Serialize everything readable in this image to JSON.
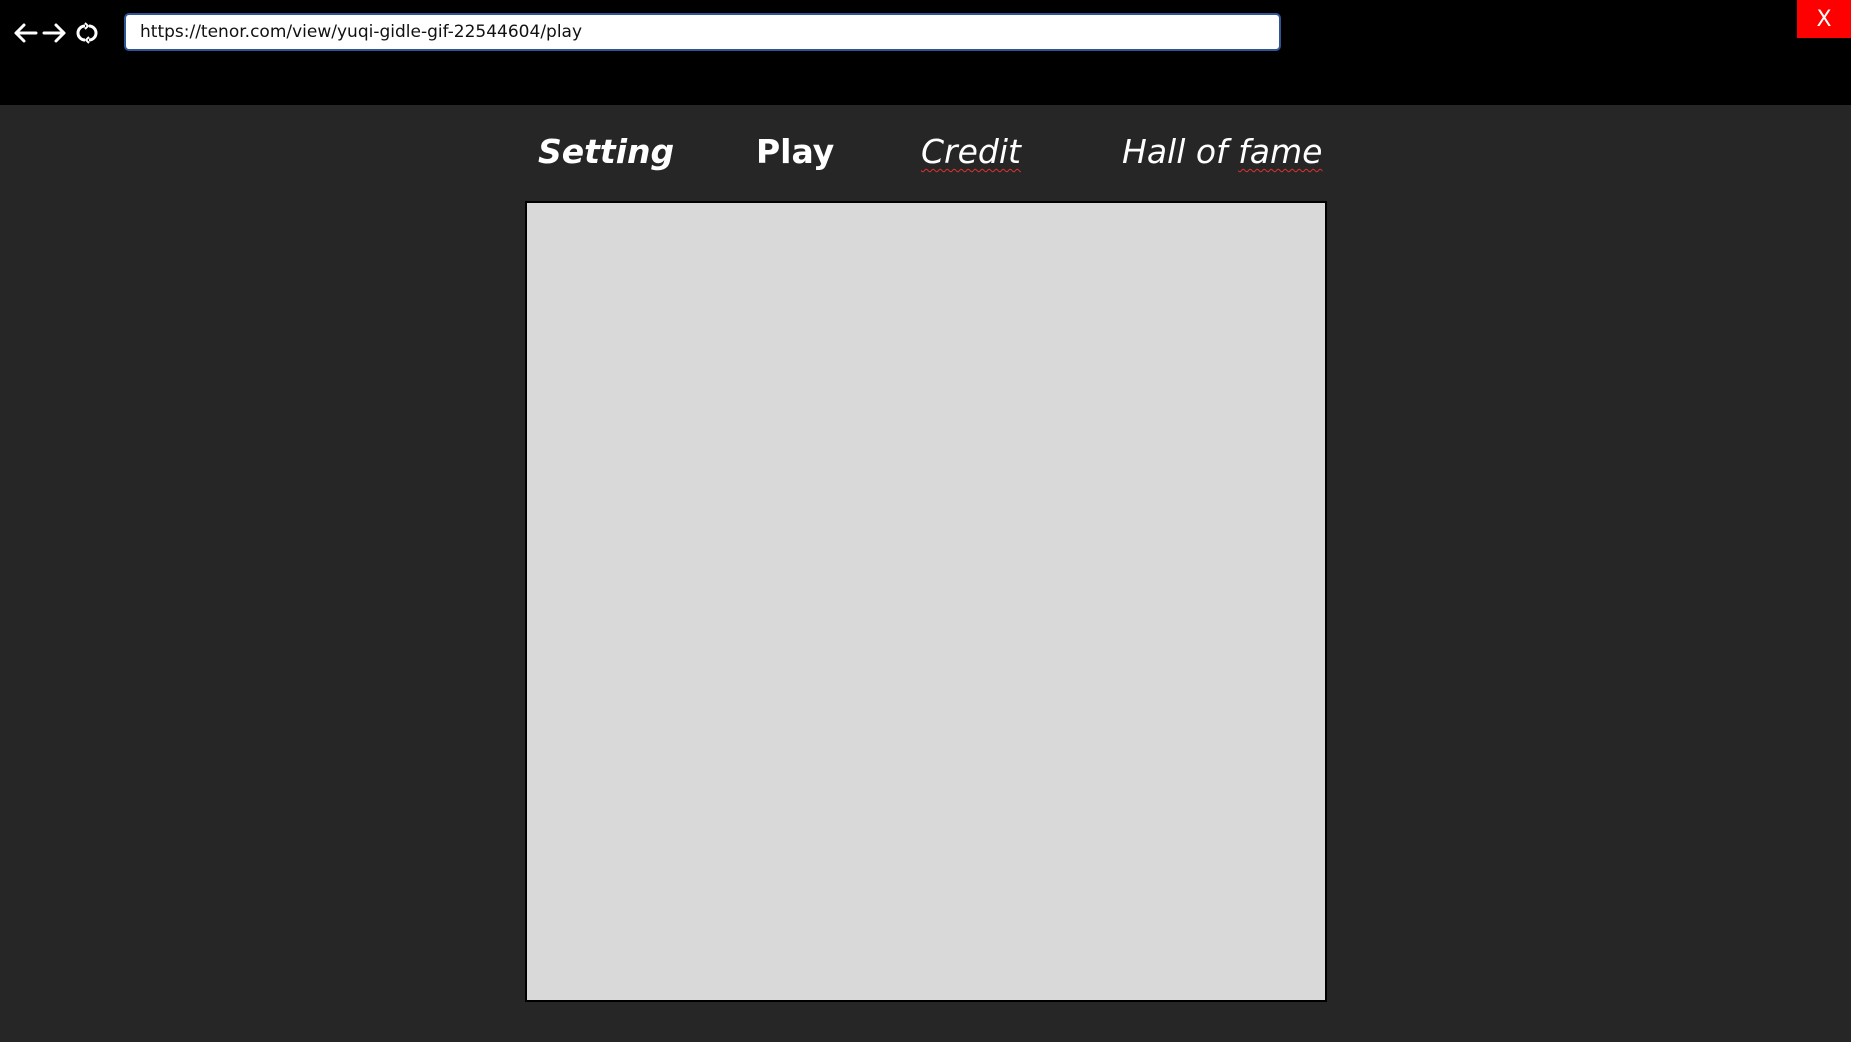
{
  "browser": {
    "back_icon": "arrow-left-icon",
    "forward_icon": "arrow-right-icon",
    "refresh_icon": "refresh-icon",
    "url": "https://tenor.com/view/yuqi-gidle-gif-22544604/play",
    "close_label": "X"
  },
  "menu": {
    "setting": "Setting",
    "play": "Play",
    "credit": "Credit",
    "hall_prefix": "Hall of ",
    "hall_suffix": "fame"
  },
  "colors": {
    "topbar": "#000000",
    "background": "#262626",
    "game_area": "#d9d9d9",
    "close_button": "#ff0000",
    "url_border": "#2f5597"
  }
}
